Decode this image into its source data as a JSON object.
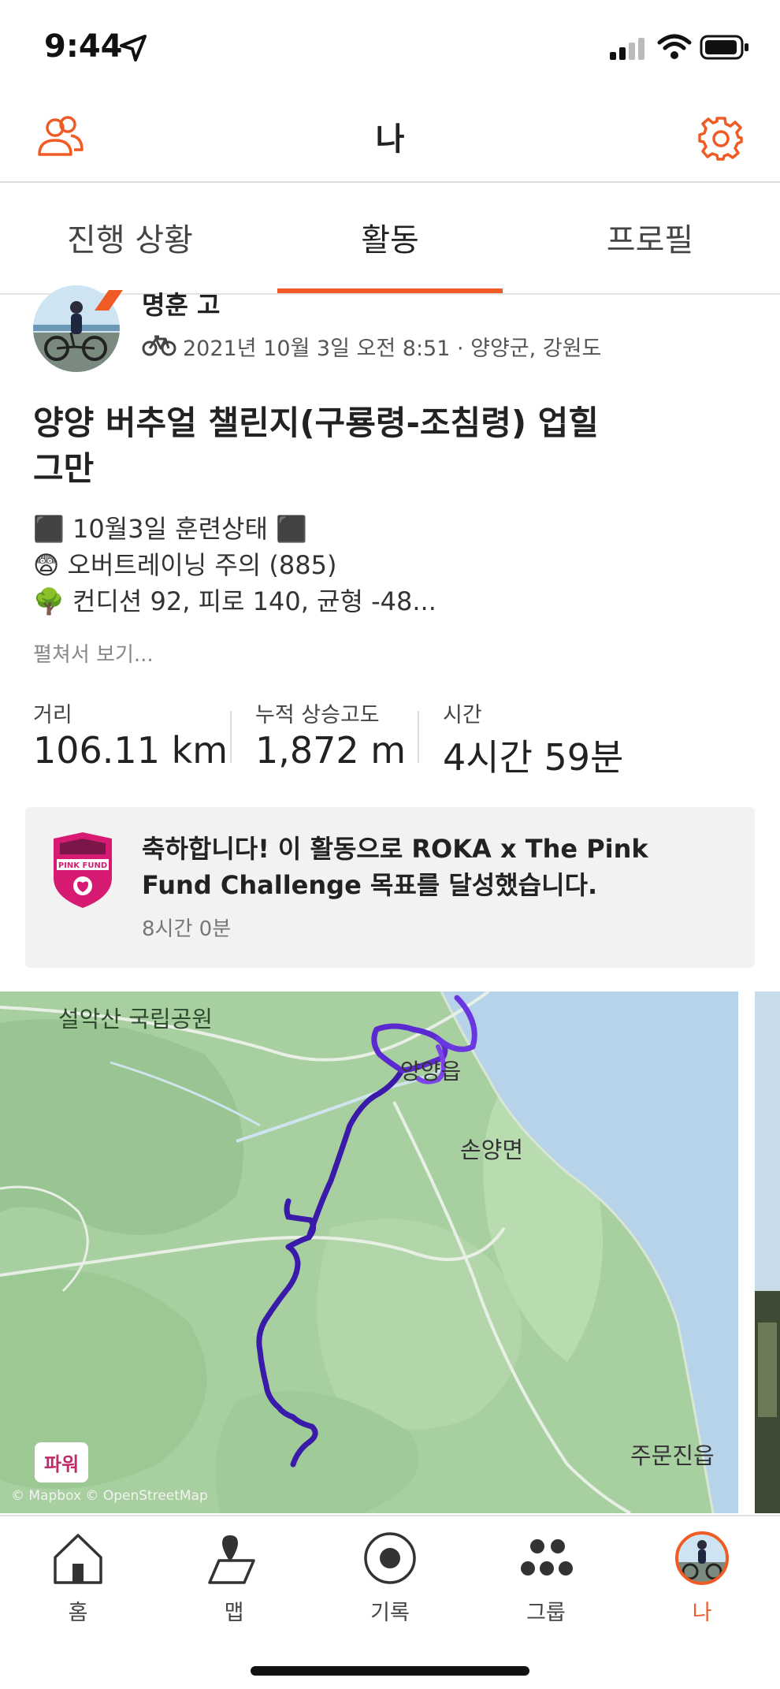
{
  "status_bar": {
    "time": "9:44"
  },
  "header": {
    "title": "나"
  },
  "tabs": [
    {
      "label": "진행 상황",
      "active": false
    },
    {
      "label": "활동",
      "active": true
    },
    {
      "label": "프로필",
      "active": false
    }
  ],
  "activity": {
    "athlete_name": "명훈 고",
    "meta": "2021년 10월 3일 오전 8:51 · 양양군, 강원도",
    "title": "양양 버추얼 챌린지(구룡령-조침령) 업힐 그만",
    "description": [
      "⬛ 10월3일 훈련상태 ⬛",
      "😨 오버트레이닝 주의 (885)",
      "🌳 컨디션 92, 피로 140, 균형 -48..."
    ],
    "expand_label": "펼쳐서 보기...",
    "stats": [
      {
        "label": "거리",
        "value": "106.11 km"
      },
      {
        "label": "누적 상승고도",
        "value": "1,872 m"
      },
      {
        "label": "시간",
        "value": "4시간 59분"
      }
    ]
  },
  "achievement": {
    "badge_text": "PINK FUND",
    "title": "축하합니다! 이 활동으로 ROKA x The Pink Fund Challenge 목표를 달성했습니다.",
    "time": "8시간 0분"
  },
  "map": {
    "labels": {
      "park": "설악산 국립공원",
      "town": "양양읍",
      "district": "손양면",
      "south": "주문진읍"
    },
    "power_badge": "파워",
    "attribution": "© Mapbox © OpenStreetMap"
  },
  "bottom_nav": [
    {
      "label": "홈",
      "icon": "home-icon",
      "active": false
    },
    {
      "label": "맵",
      "icon": "map-icon",
      "active": false
    },
    {
      "label": "기록",
      "icon": "record-icon",
      "active": false
    },
    {
      "label": "그룹",
      "icon": "groups-icon",
      "active": false
    },
    {
      "label": "나",
      "icon": "avatar",
      "active": true
    }
  ],
  "colors": {
    "accent": "#f05a24",
    "route": "#3a1aa8",
    "water": "#b6d3ea",
    "land": "#a7cf9f"
  }
}
